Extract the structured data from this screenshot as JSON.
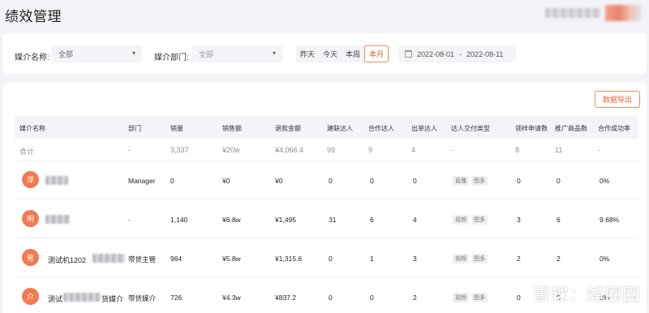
{
  "header": {
    "title": "绩效管理"
  },
  "filters": {
    "media_name_label": "媒介名称:",
    "media_name_value": "全部",
    "media_dept_label": "媒介部门:",
    "media_dept_placeholder": "全部",
    "range_tabs": [
      {
        "label": "昨天",
        "active": false
      },
      {
        "label": "今天",
        "active": false
      },
      {
        "label": "本周",
        "active": false
      },
      {
        "label": "本月",
        "active": true
      }
    ],
    "date_start": "2022-08-01",
    "date_sep": "-",
    "date_end": "2022-08-11"
  },
  "table": {
    "export_label": "数据导出",
    "columns": [
      "媒介名称",
      "部门",
      "销量",
      "销售额",
      "退款金额",
      "建联达人",
      "合作达人",
      "出单达人",
      "达人交付类型",
      "领样申请数",
      "推广商品数",
      "合作成功率"
    ],
    "total": {
      "name": "合计",
      "dept": "-",
      "sales": "3,337",
      "revenue": "¥20w",
      "refund": "¥4,066.4",
      "contacted": "99",
      "cooperated": "9",
      "ordered": "4",
      "type": "-",
      "samples": "8",
      "products": "11",
      "rate": "-"
    },
    "rows": [
      {
        "avatar": "萍",
        "name": "",
        "dept": "Manager",
        "sales": "0",
        "revenue": "¥0",
        "refund": "¥0",
        "contacted": "0",
        "cooperated": "0",
        "ordered": "0",
        "tag1": "直播",
        "tag2": "图多",
        "samples": "0",
        "products": "0",
        "rate": "0%"
      },
      {
        "avatar": "明",
        "name": "",
        "dept": "-",
        "sales": "1,140",
        "revenue": "¥6.8w",
        "refund": "¥1,495",
        "contacted": "31",
        "cooperated": "6",
        "ordered": "4",
        "tag1": "视频",
        "tag2": "图多",
        "samples": "3",
        "products": "6",
        "rate": "9.68%"
      },
      {
        "avatar": "管",
        "name": "测试机1202",
        "dept": "带货主管",
        "sales": "964",
        "revenue": "¥5.8w",
        "refund": "¥1,315.6",
        "contacted": "0",
        "cooperated": "1",
        "ordered": "3",
        "tag1": "视频",
        "tag2": "图多",
        "samples": "2",
        "products": "2",
        "rate": "0%"
      },
      {
        "avatar": "介",
        "name": "测试",
        "name_suffix": "货媒介",
        "dept": "带货媒介",
        "sales": "726",
        "revenue": "¥4.3w",
        "refund": "¥837.2",
        "contacted": "0",
        "cooperated": "0",
        "ordered": "2",
        "tag1": "视频",
        "tag2": "图多",
        "samples": "0",
        "products": "0",
        "rate": "0%"
      }
    ]
  },
  "watermark": "雪球：蝉圈圈"
}
